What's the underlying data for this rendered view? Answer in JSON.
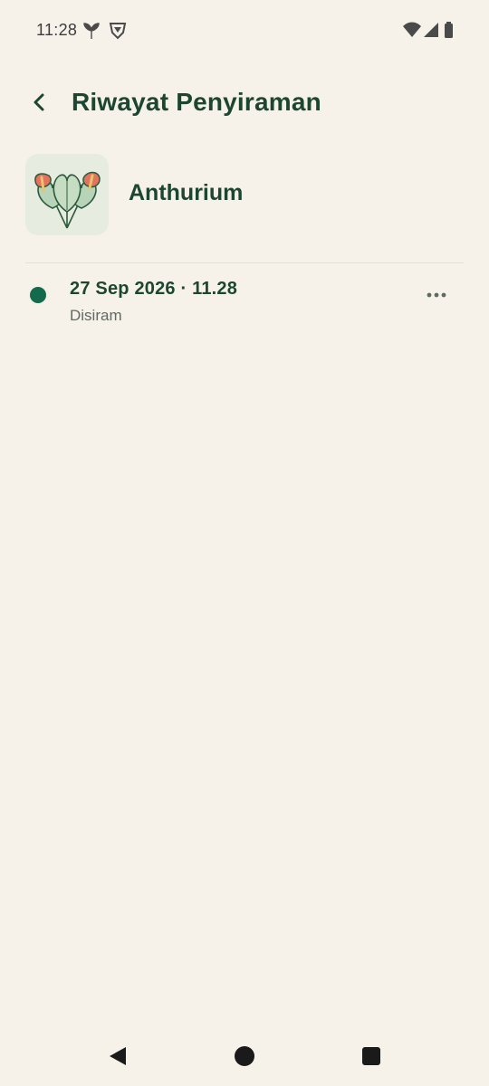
{
  "status_bar": {
    "time": "11:28",
    "icons_left": [
      "leaf-icon",
      "shield-icon"
    ],
    "icons_right": [
      "wifi-icon",
      "signal-icon",
      "battery-icon"
    ]
  },
  "header": {
    "title": "Riwayat Penyiraman",
    "back_icon": "chevron-left-icon"
  },
  "plant": {
    "name": "Anthurium",
    "thumbnail_icon": "anthurium-illustration"
  },
  "history": [
    {
      "date": "27 Sep 2026 · 11.28",
      "status": "Disiram",
      "dot_color": "#136a4c",
      "menu_icon": "more-horizontal-icon"
    }
  ],
  "nav": {
    "icons": [
      "back-triangle-icon",
      "home-circle-icon",
      "recents-square-icon"
    ]
  },
  "colors": {
    "background": "#f6f2ea",
    "primary_text": "#1d4630",
    "accent": "#136a4c",
    "secondary_text": "#5f6a63"
  }
}
